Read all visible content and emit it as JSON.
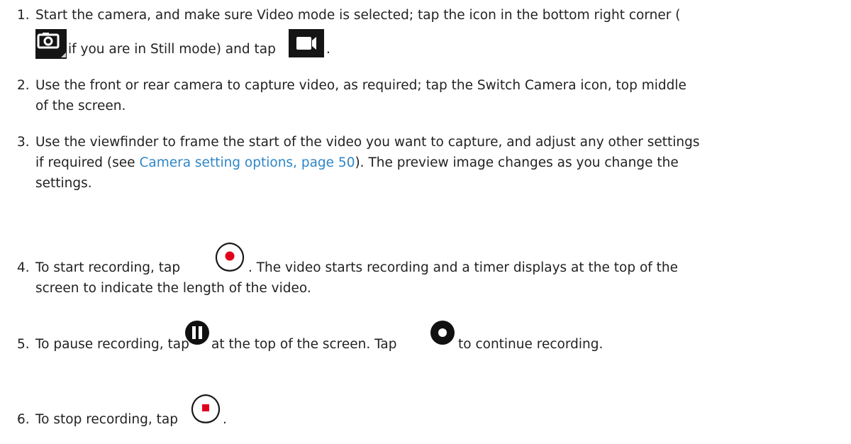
{
  "steps": [
    {
      "number": "1.",
      "line1": "Start the camera, and make sure Video mode is selected; tap the icon in the bottom right corner (",
      "line2_a": "if you are in Still mode) and tap",
      "line2_b": "."
    },
    {
      "number": "2.",
      "line1": "Use the front or rear camera to capture video, as required; tap the Switch Camera icon, top middle",
      "line2": "of the screen."
    },
    {
      "number": "3.",
      "line1": "Use the viewfinder to frame the start of the video you want to capture, and adjust any other settings",
      "line2_a": "if required (see ",
      "line2_link": "Camera setting options, page 50",
      "line2_b": "). The preview image changes as you change the",
      "line3": "settings."
    },
    {
      "number": "4.",
      "line1_a": "To start recording, tap",
      "line1_b": ". The video starts recording and a timer displays at the top of the",
      "line2": "screen to indicate the length of the video."
    },
    {
      "number": "5.",
      "line1_a": "To pause recording, tap",
      "line1_b": "at the top of the screen. Tap",
      "line1_c": "to continue recording."
    },
    {
      "number": "6.",
      "line1_a": "To stop recording, tap",
      "line1_b": "."
    }
  ],
  "icons": {
    "still_mode": "camera-still-mode-icon",
    "video_mode": "video-camera-icon",
    "record": "record-button-icon",
    "pause": "pause-button-icon",
    "resume": "resume-record-icon",
    "stop": "stop-button-icon"
  },
  "colors": {
    "text": "#222222",
    "link": "#2f86c7",
    "record_red": "#e0001b",
    "icon_dark": "#111111"
  }
}
